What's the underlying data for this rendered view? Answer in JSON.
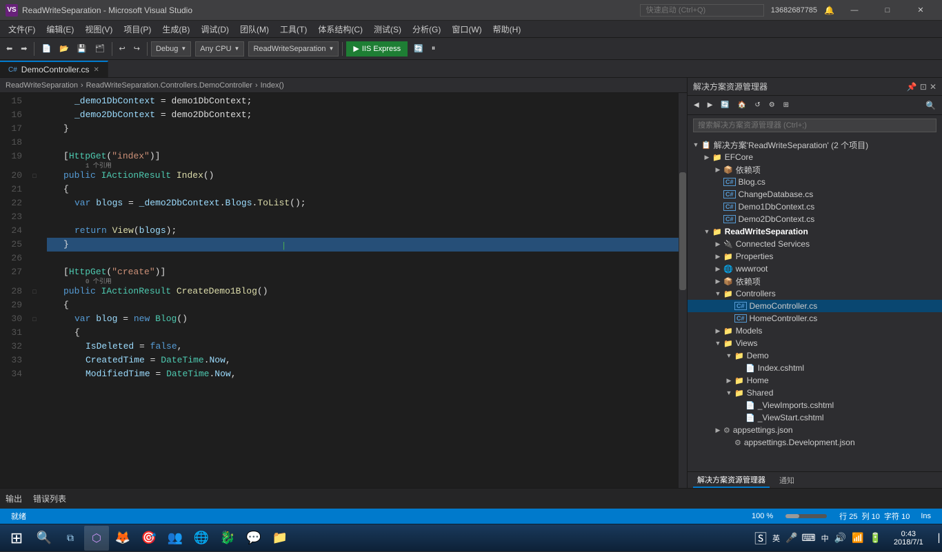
{
  "titlebar": {
    "title": "ReadWriteSeparation - Microsoft Visual Studio",
    "vs_label": "VS",
    "search_placeholder": "快速启动 (Ctrl+Q)",
    "user": "13682687785",
    "win_min": "—",
    "win_max": "□",
    "win_close": "✕"
  },
  "menubar": {
    "items": [
      "文件(F)",
      "编辑(E)",
      "视图(V)",
      "项目(P)",
      "生成(B)",
      "调试(D)",
      "团队(M)",
      "工具(T)",
      "体系结构(C)",
      "测试(S)",
      "分析(G)",
      "窗口(W)",
      "帮助(H)"
    ]
  },
  "toolbar": {
    "debug_config": "Debug",
    "platform": "Any CPU",
    "project": "ReadWriteSeparation",
    "run_label": "IIS Express",
    "undo": "↩",
    "redo": "↪"
  },
  "tabs": [
    {
      "label": "DemoController.cs",
      "active": true,
      "modified": false
    }
  ],
  "breadcrumb": {
    "project": "ReadWriteSeparation",
    "class": "ReadWriteSeparation.Controllers.DemoController",
    "method": "Index()"
  },
  "code_lines": [
    {
      "num": 15,
      "indent": 3,
      "has_collapse": false,
      "content": "_demo1DbContext = demo1DbContext;"
    },
    {
      "num": 16,
      "indent": 3,
      "content": "_demo2DbContext = demo2DbContext;"
    },
    {
      "num": 17,
      "indent": 2,
      "content": "}"
    },
    {
      "num": 18,
      "indent": 0,
      "content": ""
    },
    {
      "num": 19,
      "indent": 2,
      "content": "[HttpGet(\"index\")]"
    },
    {
      "num": "19r",
      "indent": 3,
      "content": "1 个引用",
      "is_ref": true
    },
    {
      "num": 20,
      "indent": 2,
      "has_collapse": true,
      "content": "public IActionResult Index()"
    },
    {
      "num": 21,
      "indent": 2,
      "content": "{"
    },
    {
      "num": 22,
      "indent": 3,
      "content": "var blogs = _demo2DbContext.Blogs.ToList();"
    },
    {
      "num": 23,
      "indent": 0,
      "content": ""
    },
    {
      "num": 24,
      "indent": 3,
      "content": "return View(blogs);"
    },
    {
      "num": 25,
      "indent": 2,
      "content": "}",
      "highlighted": true
    },
    {
      "num": 26,
      "indent": 0,
      "content": ""
    },
    {
      "num": 27,
      "indent": 2,
      "content": "[HttpGet(\"create\")]"
    },
    {
      "num": "27r",
      "indent": 3,
      "content": "0 个引用",
      "is_ref": true
    },
    {
      "num": 28,
      "indent": 2,
      "has_collapse": true,
      "content": "public IActionResult CreateDemo1Blog()"
    },
    {
      "num": 29,
      "indent": 2,
      "content": "{"
    },
    {
      "num": 30,
      "indent": 3,
      "has_collapse": true,
      "content": "var blog = new Blog()"
    },
    {
      "num": 31,
      "indent": 3,
      "content": "{"
    },
    {
      "num": 32,
      "indent": 4,
      "content": "IsDeleted = false,"
    },
    {
      "num": 33,
      "indent": 4,
      "content": "CreatedTime = DateTime.Now,"
    },
    {
      "num": 34,
      "indent": 4,
      "content": "ModifiedTime = DateTime.Now,"
    }
  ],
  "solution_explorer": {
    "title": "解决方案资源管理器",
    "search_placeholder": "搜索解决方案资源管理器 (Ctrl+;)",
    "tree": [
      {
        "level": 0,
        "label": "解决方案'ReadWriteSeparation' (2 个项目)",
        "icon": "📋",
        "expanded": true,
        "type": "solution"
      },
      {
        "level": 1,
        "label": "EFCore",
        "icon": "📁",
        "expanded": true,
        "type": "folder"
      },
      {
        "level": 2,
        "label": "依赖项",
        "icon": "📦",
        "expanded": false,
        "type": "deps"
      },
      {
        "level": 2,
        "label": "Blog.cs",
        "icon": "C#",
        "type": "file"
      },
      {
        "level": 2,
        "label": "ChangeDatabase.cs",
        "icon": "C#",
        "type": "file"
      },
      {
        "level": 2,
        "label": "Demo1DbContext.cs",
        "icon": "C#",
        "type": "file"
      },
      {
        "level": 2,
        "label": "Demo2DbContext.cs",
        "icon": "C#",
        "type": "file"
      },
      {
        "level": 1,
        "label": "ReadWriteSeparation",
        "icon": "📁",
        "expanded": true,
        "type": "folder",
        "bold": true
      },
      {
        "level": 2,
        "label": "Connected Services",
        "icon": "🔌",
        "type": "folder"
      },
      {
        "level": 2,
        "label": "Properties",
        "icon": "📁",
        "expanded": false,
        "type": "folder"
      },
      {
        "level": 2,
        "label": "wwwroot",
        "icon": "🌐",
        "type": "folder"
      },
      {
        "level": 2,
        "label": "依赖项",
        "icon": "📦",
        "type": "deps"
      },
      {
        "level": 2,
        "label": "Controllers",
        "icon": "📁",
        "expanded": true,
        "type": "folder"
      },
      {
        "level": 3,
        "label": "DemoController.cs",
        "icon": "C#",
        "type": "file",
        "selected": true
      },
      {
        "level": 3,
        "label": "HomeController.cs",
        "icon": "C#",
        "type": "file"
      },
      {
        "level": 2,
        "label": "Models",
        "icon": "📁",
        "expanded": false,
        "type": "folder"
      },
      {
        "level": 2,
        "label": "Views",
        "icon": "📁",
        "expanded": true,
        "type": "folder"
      },
      {
        "level": 3,
        "label": "Demo",
        "icon": "📁",
        "expanded": true,
        "type": "folder"
      },
      {
        "level": 4,
        "label": "Index.cshtml",
        "icon": "📄",
        "type": "file"
      },
      {
        "level": 3,
        "label": "Home",
        "icon": "📁",
        "expanded": false,
        "type": "folder"
      },
      {
        "level": 3,
        "label": "Shared",
        "icon": "📁",
        "expanded": true,
        "type": "folder"
      },
      {
        "level": 4,
        "label": "_ViewImports.cshtml",
        "icon": "📄",
        "type": "file"
      },
      {
        "level": 4,
        "label": "_ViewStart.cshtml",
        "icon": "📄",
        "type": "file"
      },
      {
        "level": 2,
        "label": "appsettings.json",
        "icon": "⚙",
        "type": "file"
      },
      {
        "level": 2,
        "label": "appsettings.Development.json",
        "icon": "⚙",
        "type": "file"
      }
    ],
    "bottom_tabs": [
      "解决方案资源管理器",
      "通知"
    ]
  },
  "bottom_panel": {
    "items": [
      "输出",
      "错误列表"
    ]
  },
  "statusbar": {
    "status": "就绪",
    "row": "行 25",
    "col": "列 10",
    "char": "字符 10",
    "ins": "Ins",
    "zoom": "100 %"
  },
  "taskbar": {
    "time": "0:43",
    "date": "2018/7/1",
    "lang": "英",
    "start_icon": "⊞"
  }
}
